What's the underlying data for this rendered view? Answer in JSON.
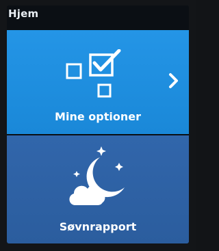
{
  "header": {
    "title": "Hjem"
  },
  "tiles": [
    {
      "label": "Mine optioner",
      "icon": "checkbox-options-icon",
      "color": "#1f8fe0"
    },
    {
      "label": "Søvnrapport",
      "icon": "moon-cloud-stars-icon",
      "color": "#2f63a6"
    }
  ],
  "chevron_icon": "chevron-right-icon"
}
